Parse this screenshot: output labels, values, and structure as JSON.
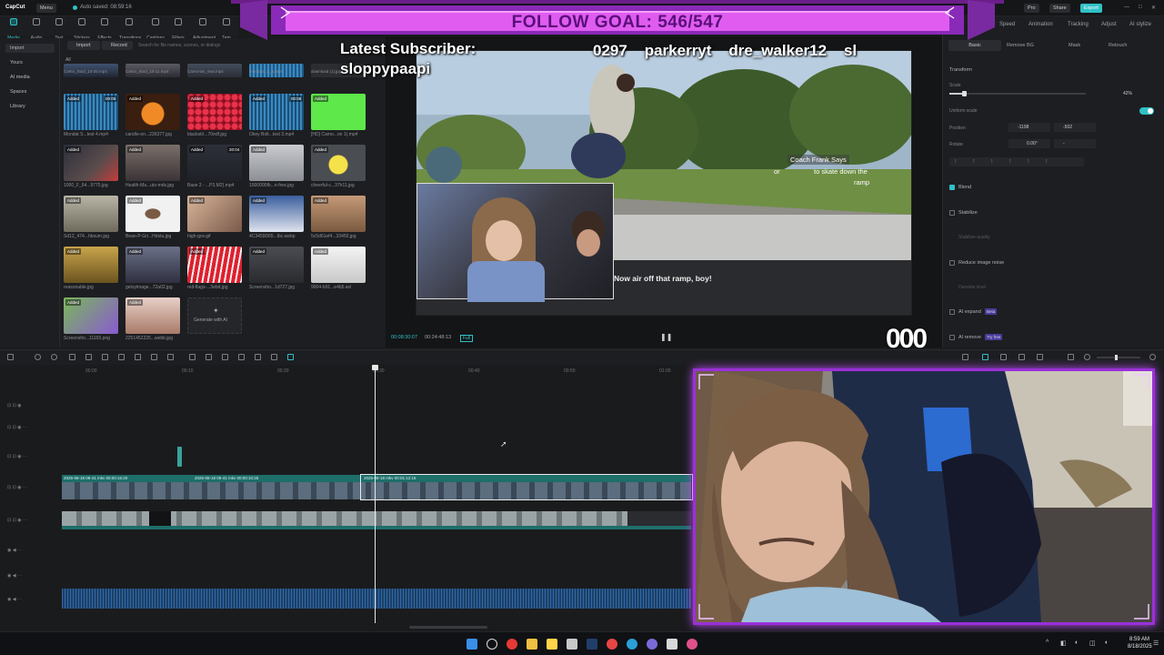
{
  "app": {
    "name": "CapCut",
    "menu_label": "Menu",
    "autosave": "Auto saved: 08:59:16",
    "pro_label": "Pro",
    "share_label": "Share",
    "export_label": "Export"
  },
  "media_tabs": [
    {
      "label": "Media",
      "icon": "media-icon"
    },
    {
      "label": "Audio",
      "icon": "audio-icon"
    },
    {
      "label": "Text",
      "icon": "text-icon"
    },
    {
      "label": "Stickers",
      "icon": "sticker-icon"
    },
    {
      "label": "Effects",
      "icon": "effects-icon"
    },
    {
      "label": "Transitions",
      "icon": "transition-icon"
    },
    {
      "label": "Captions",
      "icon": "captions-icon"
    },
    {
      "label": "Filters",
      "icon": "filter-icon"
    },
    {
      "label": "Adjustment",
      "icon": "adjust-icon"
    },
    {
      "label": "Tem",
      "icon": "template-icon"
    }
  ],
  "sidebar": {
    "items": [
      "Import",
      "Yours",
      "AI media",
      "Spaces",
      "Library"
    ]
  },
  "media": {
    "import_label": "Import",
    "record_label": "Record",
    "search_placeholder": "Search for file names, scenes, or dialogs",
    "all_label": "All",
    "added_label": "Added",
    "generate_label": "Generate with AI",
    "thumbs": [
      {
        "cap": "Camo_Stud_10-25.mp4"
      },
      {
        "cap": "Camo_Stud_10-11.mp4"
      },
      {
        "cap": "Camo-lav_mwi.mp4"
      },
      {
        "cap": "monicat...2_4.mp4"
      },
      {
        "cap": "download (1).jpg"
      },
      {
        "cap": "Mondat S...test 4.mp4",
        "dur": "00:05"
      },
      {
        "cap": "candle-on...236377.jpg"
      },
      {
        "cap": "blackstrl...70edf.jpg"
      },
      {
        "cap": "Okey Bolt...test 3.mp4",
        "dur": "00:06"
      },
      {
        "cap": "[HD] Camo...on 1).mp4"
      },
      {
        "cap": "1000_F_64...9775.jpg"
      },
      {
        "cap": "Health-Ma...uts-mds.jpg"
      },
      {
        "cap": "Base 3 - ...P3.M2).mp4",
        "dur": "20:04"
      },
      {
        "cap": "1000000fb...n-free.jpg"
      },
      {
        "cap": "cheerful-c...37h11.jpg"
      },
      {
        "cap": "Sd12_474...hbsum.jpg"
      },
      {
        "cap": "Bean-P-Gri...Hdstu.jpg"
      },
      {
        "cap": "high-gov.gif"
      },
      {
        "cap": "4C3459D65...lbc.webp"
      },
      {
        "cap": "5c5d61ef4...33450.jpg"
      },
      {
        "cap": "reasonable.jpg"
      },
      {
        "cap": "getsyimage...72a02.jpg"
      },
      {
        "cap": "red-flags-...3ebd.jpg"
      },
      {
        "cap": "Screensho...1d727.jpg"
      },
      {
        "cap": "9004-b91...e4b5.sel"
      },
      {
        "cap": "Screensho...11165.png"
      },
      {
        "cap": "2251452225...webb.jpg"
      }
    ]
  },
  "player": {
    "current_time": "00:08:30:07",
    "total_time": "00:24:48:13",
    "quality": "Full",
    "caption_name": "Coach Frank Says",
    "caption_line1": "to skate down the",
    "caption_line2": "ramp",
    "caption_or": "or",
    "subtitle": "Now air off that ramp, boy!"
  },
  "right_panel": {
    "top_tabs": [
      "Video",
      "Audio",
      "Speed",
      "Animation",
      "Tracking",
      "Adjust",
      "AI stylize"
    ],
    "sub_tabs": [
      "Basic",
      "Remove BG",
      "Mask",
      "Retouch"
    ],
    "transform_label": "Transform",
    "scale_label": "Scale",
    "scale_value": "42%",
    "scale_fraction": 0.42,
    "uniform_scale_label": "Uniform scale",
    "position_label": "Position",
    "position_x": "-1198",
    "position_y": "-502",
    "rotate_label": "Rotate",
    "rotate_value": "0.00°",
    "rotate_extra": "-",
    "blend_label": "Blend",
    "stabilize_label": "Stabilize",
    "stabilize_hint": "Stabilize quality",
    "noise_label": "Reduce image noise",
    "noise_hint": "Denoise level",
    "expand_label": "AI expand",
    "expand_badge": "Beta",
    "remove_label": "AI remove",
    "remove_badge": "Try free"
  },
  "timeline": {
    "ruler": [
      "00:00",
      "00:10",
      "00:20",
      "00:30",
      "00:40",
      "00:50",
      "01:00"
    ],
    "clip_labels": [
      "2025-08-18 09-41 mkv 00:00:16:20",
      "2025-08-18 09-41 mkv 00:00:10:25",
      "2025-08-18 mkv 00:01:12:15"
    ]
  },
  "overlay": {
    "follow_goal": "FOLLOW GOAL: 546/547",
    "latest_sub_label": "Latest Subscriber:",
    "latest_sub_name": "sloppypaapi",
    "ticker": "0297    parkerryt    dre_walker12    sl",
    "counter": "000"
  },
  "taskbar": {
    "time": "8:59 AM",
    "date": "8/18/2025"
  },
  "colors": {
    "accent": "#2fc1c6",
    "overlay_purple": "#b83cf0",
    "overlay_bar": "#e45ff0"
  }
}
